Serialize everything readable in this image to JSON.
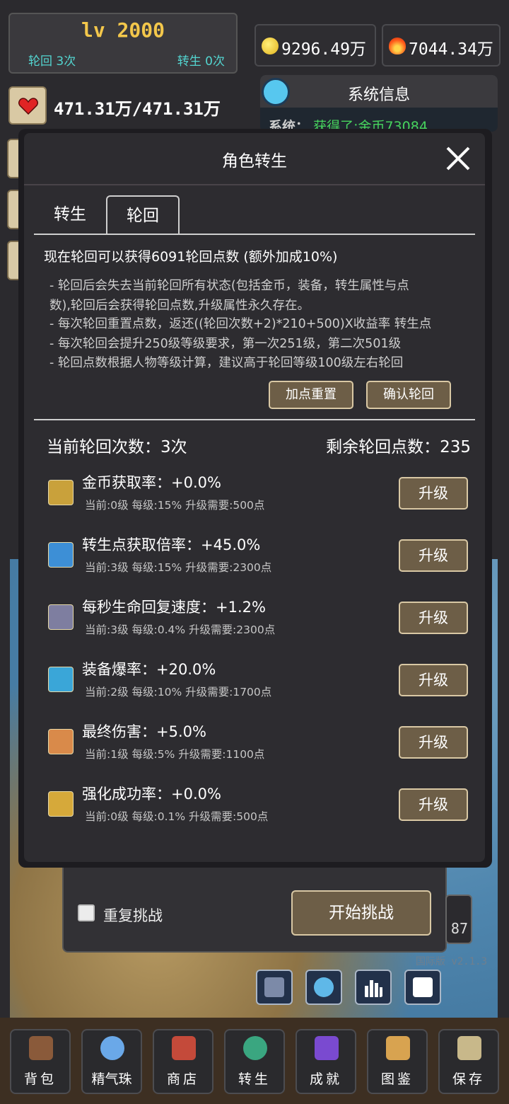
{
  "hud": {
    "level": "lv 2000",
    "lunhui_count": "轮回 3次",
    "zhuansheng_count": "转生 0次",
    "coins": "9296.49万",
    "fire": "7044.34万",
    "hp": "471.31万/471.31万"
  },
  "system_info": {
    "title": "系统信息",
    "line_prefix": "系统：",
    "line_msg": "获得了:金币73084"
  },
  "modal": {
    "title": "角色转生",
    "tabs": [
      "转生",
      "轮回"
    ],
    "active_tab": "轮回",
    "gain_line": "现在轮回可以获得6091轮回点数 (额外加成10%)",
    "desc": [
      "- 轮回后会失去当前轮回所有状态(包括金币，装备，转生属性与点",
      "数),轮回后会获得轮回点数,升级属性永久存在。",
      "- 每次轮回重置点数，返还((轮回次数+2)*210+500)X收益率 转生点",
      "- 每次轮回会提升250级等级要求，第一次251级，第二次501级",
      "- 轮回点数根据人物等级计算，建议高于轮回等级100级左右轮回"
    ],
    "reset_button": "加点重置",
    "confirm_button": "确认轮回",
    "current_count": "当前轮回次数：3次",
    "remaining_points": "剩余轮回点数：235",
    "upgrade_label": "升级",
    "attributes": [
      {
        "name": "金币获取率：+0.0%",
        "info": "当前:0级  每级:15%  升级需要:500点",
        "icon": "coin-rate-icon",
        "color": "#c9a13b"
      },
      {
        "name": "转生点获取倍率：+45.0%",
        "info": "当前:3级  每级:15%  升级需要:2300点",
        "icon": "rebirth-rate-icon",
        "color": "#3d8fd6"
      },
      {
        "name": "每秒生命回复速度：+1.2%",
        "info": "当前:3级  每级:0.4%  升级需要:2300点",
        "icon": "hp-regen-icon",
        "color": "#7e7ea0"
      },
      {
        "name": "装备爆率：+20.0%",
        "info": "当前:2级  每级:10%  升级需要:1700点",
        "icon": "drop-rate-icon",
        "color": "#3aa6d8"
      },
      {
        "name": "最终伤害：+5.0%",
        "info": "当前:1级  每级:5%  升级需要:1100点",
        "icon": "final-damage-icon",
        "color": "#d98a4a"
      },
      {
        "name": "强化成功率：+0.0%",
        "info": "当前:0级  每级:0.1%  升级需要:500点",
        "icon": "enhance-rate-icon",
        "color": "#d6a93a"
      }
    ]
  },
  "challenge": {
    "repeat_label": "重复挑战",
    "start_button": "开始挑战",
    "badge": "87",
    "version": "国际版 v2.1.3"
  },
  "bottom_nav": [
    {
      "label": "背包",
      "icon": "bag-icon",
      "color": "#8a5a3a"
    },
    {
      "label": "精气珠",
      "icon": "orb-icon",
      "color": "#6aa8e8"
    },
    {
      "label": "商店",
      "icon": "shop-icon",
      "color": "#c44a3a"
    },
    {
      "label": "转生",
      "icon": "globe-icon",
      "color": "#3aa680"
    },
    {
      "label": "成就",
      "icon": "book-icon",
      "color": "#7a4ad0"
    },
    {
      "label": "图鉴",
      "icon": "scroll-icon",
      "color": "#d8a350"
    },
    {
      "label": "保存",
      "icon": "save-scroll-icon",
      "color": "#c8b88a"
    }
  ]
}
